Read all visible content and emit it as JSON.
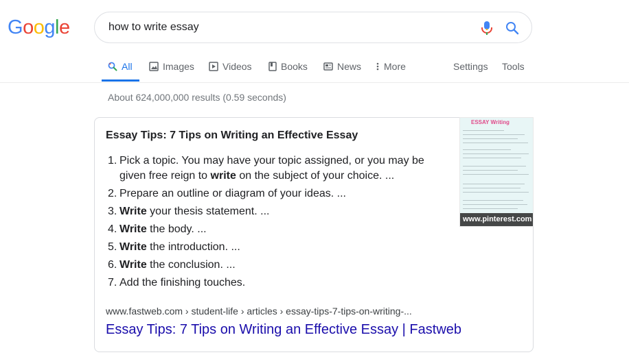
{
  "logo": {
    "letters": [
      "G",
      "o",
      "o",
      "g",
      "l",
      "e"
    ]
  },
  "search": {
    "query": "how to write essay",
    "mic_icon": "mic-icon",
    "search_icon": "search-icon"
  },
  "tabs": [
    {
      "label": "All",
      "icon": "search-icon",
      "active": true
    },
    {
      "label": "Images",
      "icon": "image-icon"
    },
    {
      "label": "Videos",
      "icon": "play-icon"
    },
    {
      "label": "Books",
      "icon": "book-icon"
    },
    {
      "label": "News",
      "icon": "newspaper-icon"
    },
    {
      "label": "More",
      "icon": "kebab-icon"
    }
  ],
  "tools": {
    "settings": "Settings",
    "tools": "Tools"
  },
  "result_stats": "About 624,000,000 results (0.59 seconds)",
  "snippet": {
    "title": "Essay Tips: 7 Tips on Writing an Effective Essay",
    "steps": [
      {
        "num": "1.",
        "pre": "Pick a topic. You may have your topic assigned, or you may be given free reign to ",
        "bold": "write",
        "post": " on the subject of your choice. ..."
      },
      {
        "num": "2.",
        "pre": "Prepare an outline or diagram of your ideas. ...",
        "bold": "",
        "post": ""
      },
      {
        "num": "3.",
        "pre": "",
        "bold": "Write",
        "post": " your thesis statement. ..."
      },
      {
        "num": "4.",
        "pre": "",
        "bold": "Write",
        "post": " the body. ..."
      },
      {
        "num": "5.",
        "pre": "",
        "bold": "Write",
        "post": " the introduction. ..."
      },
      {
        "num": "6.",
        "pre": "",
        "bold": "Write",
        "post": " the conclusion. ..."
      },
      {
        "num": "7.",
        "pre": "Add the finishing touches.",
        "bold": "",
        "post": ""
      }
    ],
    "thumbnail": {
      "header": "ESSAY Writing",
      "caption": "www.pinterest.com"
    },
    "cite": "www.fastweb.com › student-life › articles › essay-tips-7-tips-on-writing-...",
    "link_text": "Essay Tips: 7 Tips on Writing an Effective Essay | Fastweb"
  },
  "colors": {
    "link": "#1a0dab",
    "active_tab": "#1a73e8",
    "muted": "#70757a"
  }
}
